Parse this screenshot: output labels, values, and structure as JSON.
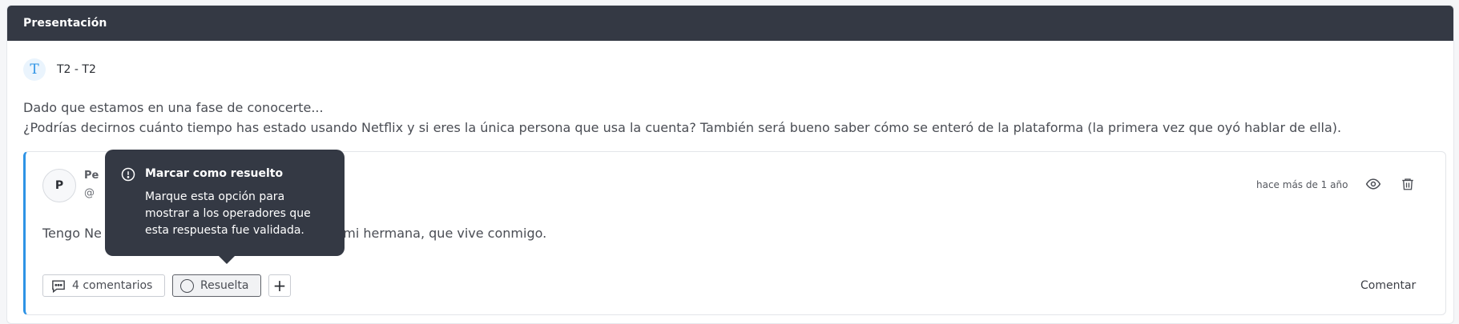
{
  "panel": {
    "title": "Presentación"
  },
  "topic": {
    "icon": "text-type-icon",
    "icon_glyph": "T",
    "label": "T2 - T2"
  },
  "question": {
    "line1": "Dado que estamos en una fase de conocerte...",
    "line2": "¿Podrías decirnos cuánto tiempo has estado usando Netflix y si eres la única persona que usa la cuenta? También será bueno saber cómo se enteró de la plataforma (la primera vez que oyó hablar de ella)."
  },
  "answer": {
    "avatar_initial": "P",
    "author_name_visible": "Pe",
    "author_handle_visible": "@",
    "timestamp": "hace más de 1 año",
    "text_start": "Tengo Ne",
    "text_end": "arto con mi hermana, que vive conmigo.",
    "actions": {
      "comments_label": "4 comentarios",
      "resolved_label": "Resuelta",
      "add_label": "+",
      "comment_link": "Comentar"
    }
  },
  "tooltip": {
    "title": "Marcar como resuelto",
    "body": "Marque esta opción para mostrar a los operadores que esta respuesta fue validada."
  },
  "colors": {
    "header_bg": "#343944",
    "accent": "#2e93e5",
    "tooltip_bg": "#343944"
  }
}
